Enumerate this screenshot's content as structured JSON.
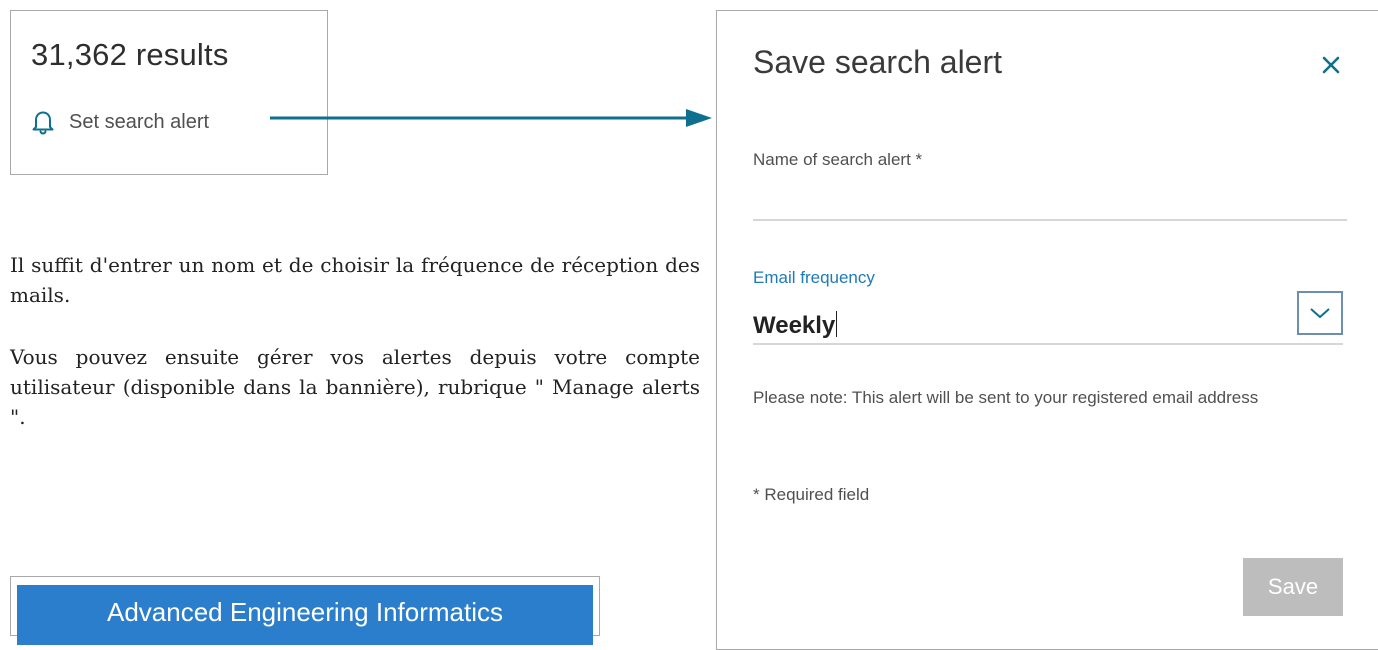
{
  "results": {
    "count_text": "31,362 results",
    "set_alert_label": "Set search alert"
  },
  "instructions": {
    "paragraph_1": "Il suffit d'entrer un nom et de choisir la fréquence de réception des mails.",
    "paragraph_2": "Vous pouvez ensuite gérer vos alertes depuis votre compte utilisateur (disponible dans la bannière), rubrique \" Manage alerts \"."
  },
  "journal_banner": {
    "title": "Advanced Engineering Informatics"
  },
  "modal": {
    "title": "Save search alert",
    "name_label": "Name of search alert *",
    "name_value": "",
    "frequency_label": "Email frequency",
    "frequency_value": "Weekly",
    "note": "Please note: This alert will be sent to your registered email address",
    "required_note": "* Required field",
    "save_label": "Save"
  },
  "colors": {
    "accent": "#0f6f8f",
    "frequency_label": "#1e7ab8",
    "banner": "#2a7ecb",
    "save_disabled": "#bdbdbd"
  },
  "icons": [
    "bell-icon",
    "close-icon",
    "chevron-down-icon"
  ]
}
